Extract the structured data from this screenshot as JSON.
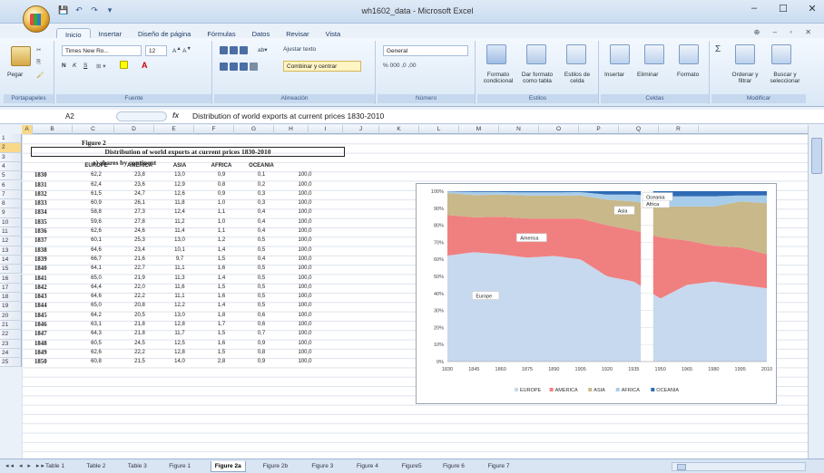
{
  "window": {
    "title": "wh1602_data - Microsoft Excel",
    "controls": [
      "–",
      "☐",
      "✕"
    ]
  },
  "quick_access": [
    "💾",
    "↶",
    "↷",
    "▾"
  ],
  "ribbon": {
    "tabs": [
      "Inicio",
      "Insertar",
      "Diseño de página",
      "Fórmulas",
      "Datos",
      "Revisar",
      "Vista"
    ],
    "active_tab": "Inicio",
    "help_icons": "⊕ – ▫ ✕",
    "clipboard": {
      "paste": "Pegar",
      "label": "Portapapeles"
    },
    "font": {
      "name": "Times New Ro...",
      "size": "12",
      "label": "Fuente",
      "bold": "N",
      "italic": "K",
      "underline": "S"
    },
    "alignment": {
      "wrap": "Ajustar texto",
      "merge": "Combinar y centrar",
      "label": "Alineación"
    },
    "number": {
      "format": "General",
      "label": "Número",
      "symbols": "% 000 ,0 ,00"
    },
    "styles": {
      "conditional": "Formato condicional",
      "table": "Dar formato como tabla",
      "cell": "Estilos de celda",
      "label": "Estilos"
    },
    "cells": {
      "insert": "Insertar",
      "delete": "Eliminar",
      "format": "Formato",
      "label": "Celdas"
    },
    "editing": {
      "sort": "Ordenar y filtrar",
      "find": "Buscar y seleccionar",
      "label": "Modificar"
    }
  },
  "formula_bar": {
    "cell_ref": "A2",
    "fx": "fx",
    "content": "Distribution of world exports at current prices 1830-2010"
  },
  "columns": [
    "A",
    "B",
    "C",
    "D",
    "E",
    "F",
    "G",
    "H",
    "I",
    "J",
    "K",
    "L",
    "M",
    "N",
    "O",
    "P",
    "Q",
    "R"
  ],
  "sheet": {
    "figure_label": "Figure 2",
    "title": "Distribution of world exports at current prices 1830-2010",
    "subtitle": "a) shares by continent",
    "headers": [
      "EUROPE",
      "AMERICA",
      "ASIA",
      "AFRICA",
      "OCEANIA"
    ],
    "rows": [
      {
        "row": "5",
        "year": "1830",
        "v": [
          "62,2",
          "23,8",
          "13,0",
          "0,9",
          "0,1",
          "100,0"
        ]
      },
      {
        "row": "6",
        "year": "1831",
        "v": [
          "62,4",
          "23,6",
          "12,9",
          "0,8",
          "0,2",
          "100,0"
        ]
      },
      {
        "row": "7",
        "year": "1832",
        "v": [
          "61,5",
          "24,7",
          "12,6",
          "0,9",
          "0,3",
          "100,0"
        ]
      },
      {
        "row": "8",
        "year": "1833",
        "v": [
          "60,9",
          "26,1",
          "11,8",
          "1,0",
          "0,3",
          "100,0"
        ]
      },
      {
        "row": "9",
        "year": "1834",
        "v": [
          "58,8",
          "27,3",
          "12,4",
          "1,1",
          "0,4",
          "100,0"
        ]
      },
      {
        "row": "10",
        "year": "1835",
        "v": [
          "59,6",
          "27,8",
          "11,2",
          "1,0",
          "0,4",
          "100,0"
        ]
      },
      {
        "row": "11",
        "year": "1836",
        "v": [
          "62,6",
          "24,6",
          "11,4",
          "1,1",
          "0,4",
          "100,0"
        ]
      },
      {
        "row": "12",
        "year": "1837",
        "v": [
          "60,1",
          "25,3",
          "13,0",
          "1,2",
          "0,5",
          "100,0"
        ]
      },
      {
        "row": "13",
        "year": "1838",
        "v": [
          "64,6",
          "23,4",
          "10,1",
          "1,4",
          "0,5",
          "100,0"
        ]
      },
      {
        "row": "14",
        "year": "1839",
        "v": [
          "66,7",
          "21,6",
          "9,7",
          "1,5",
          "0,4",
          "100,0"
        ]
      },
      {
        "row": "15",
        "year": "1840",
        "v": [
          "64,1",
          "22,7",
          "11,1",
          "1,6",
          "0,5",
          "100,0"
        ]
      },
      {
        "row": "16",
        "year": "1841",
        "v": [
          "65,0",
          "21,9",
          "11,3",
          "1,4",
          "0,5",
          "100,0"
        ]
      },
      {
        "row": "17",
        "year": "1842",
        "v": [
          "64,4",
          "22,0",
          "11,6",
          "1,5",
          "0,5",
          "100,0"
        ]
      },
      {
        "row": "18",
        "year": "1843",
        "v": [
          "64,6",
          "22,2",
          "11,1",
          "1,6",
          "0,5",
          "100,0"
        ]
      },
      {
        "row": "19",
        "year": "1844",
        "v": [
          "65,0",
          "20,8",
          "12,2",
          "1,4",
          "0,5",
          "100,0"
        ]
      },
      {
        "row": "20",
        "year": "1845",
        "v": [
          "64,2",
          "20,5",
          "13,0",
          "1,8",
          "0,6",
          "100,0"
        ]
      },
      {
        "row": "21",
        "year": "1846",
        "v": [
          "63,1",
          "21,8",
          "12,8",
          "1,7",
          "0,6",
          "100,0"
        ]
      },
      {
        "row": "22",
        "year": "1847",
        "v": [
          "64,3",
          "21,8",
          "11,7",
          "1,5",
          "0,7",
          "100,0"
        ]
      },
      {
        "row": "23",
        "year": "1848",
        "v": [
          "60,5",
          "24,5",
          "12,5",
          "1,6",
          "0,9",
          "100,0"
        ]
      },
      {
        "row": "24",
        "year": "1849",
        "v": [
          "62,6",
          "22,2",
          "12,8",
          "1,5",
          "0,8",
          "100,0"
        ]
      },
      {
        "row": "25",
        "year": "1850",
        "v": [
          "60,8",
          "21,5",
          "14,0",
          "2,8",
          "0,9",
          "100,0"
        ]
      }
    ]
  },
  "chart_data": {
    "type": "area",
    "stacked": "percent",
    "x": [
      1830,
      1845,
      1860,
      1875,
      1890,
      1905,
      1920,
      1935,
      1950,
      1965,
      1980,
      1995,
      2010
    ],
    "x_tick_labels": [
      "1830",
      "1845",
      "1860",
      "1875",
      "1890",
      "1905",
      "1920",
      "1935",
      "1950",
      "1965",
      "1980",
      "1995",
      "2010"
    ],
    "y_tick_labels": [
      "0%",
      "10%",
      "20%",
      "30%",
      "40%",
      "50%",
      "60%",
      "70%",
      "80%",
      "90%",
      "100%"
    ],
    "ylim": [
      0,
      100
    ],
    "gap": [
      1939,
      1946
    ],
    "series": [
      {
        "name": "EUROPE",
        "color": "#c7d9ee",
        "values": [
          62.2,
          64.2,
          63.0,
          61.0,
          62.0,
          60.0,
          50.0,
          47.0,
          37.0,
          45.0,
          47.0,
          45.0,
          43.0
        ]
      },
      {
        "name": "AMERICA",
        "color": "#f08080",
        "values": [
          23.8,
          20.5,
          22.0,
          23.0,
          22.0,
          24.0,
          30.0,
          30.0,
          36.0,
          26.0,
          21.0,
          22.0,
          20.0
        ]
      },
      {
        "name": "ASIA",
        "color": "#c8b88a",
        "values": [
          13.0,
          13.0,
          13.0,
          13.5,
          13.5,
          13.5,
          15.0,
          17.0,
          18.0,
          20.0,
          23.0,
          27.0,
          30.0
        ]
      },
      {
        "name": "AFRICA",
        "color": "#a8cdea",
        "values": [
          0.9,
          1.8,
          1.5,
          1.8,
          1.8,
          2.0,
          3.0,
          4.0,
          6.0,
          6.0,
          6.0,
          3.5,
          4.5
        ]
      },
      {
        "name": "OCEANIA",
        "color": "#2f6bb5",
        "values": [
          0.1,
          0.5,
          0.5,
          0.7,
          0.7,
          0.5,
          2.0,
          2.0,
          3.0,
          3.0,
          3.0,
          2.5,
          2.5
        ]
      }
    ],
    "annotations": [
      "Europe",
      "America",
      "Asia",
      "Africa",
      "Oceania"
    ],
    "legend": [
      "EUROPE",
      "AMERICA",
      "ASIA",
      "AFRICA",
      "OCEANIA"
    ],
    "legend_position": "bottom"
  },
  "sheet_tabs": [
    "Table 1",
    "Table 2",
    "Table 3",
    "Figure 1",
    "Figure 2a",
    "Figure 2b",
    "Figure 3",
    "Figure 4",
    "Figure5",
    "Figure 6",
    "Figure 7"
  ],
  "active_sheet": "Figure 2a",
  "nav_arrows": "◂◂ ◂ ▸ ▸▸"
}
